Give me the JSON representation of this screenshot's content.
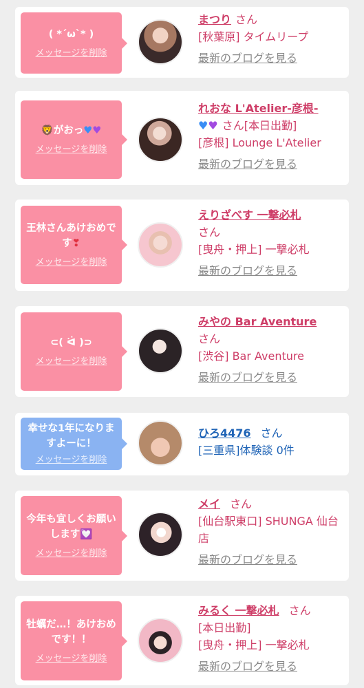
{
  "delete_label": "メッセージを削除",
  "san_label": "さん",
  "blog_label": "最新のブログを見る",
  "colors": {
    "pink_bubble": "#fa90a4",
    "blue_bubble": "#8ab3f2",
    "name_pink": "#ce3d67",
    "name_blue": "#1e63b6",
    "link_gray": "#8a8a8a"
  },
  "items": [
    {
      "message": "( *´ω`* )",
      "name": "まつり",
      "lines": [
        "[秋葉原] タイムリープ"
      ]
    },
    {
      "message": "がおっ",
      "name": "れおな L'Atelier-彦根-",
      "lines": [
        "[本日出勤]",
        "[彦根] Lounge L'Atelier"
      ]
    },
    {
      "message": "王林さんあけおめです",
      "name": "えりざべす 一撃必札",
      "lines": [
        "[曳舟・押上] 一撃必札"
      ]
    },
    {
      "message": "⊂( ᐛ )⊃",
      "name": "みやの Bar Aventure",
      "lines": [
        "[渋谷] Bar Aventure"
      ]
    },
    {
      "message": "幸せな1年になりますよーに！",
      "name": "ひろ4476",
      "lines": [
        "[三重県]体験談 0件"
      ]
    },
    {
      "message": "今年も宜しくお願いします",
      "name": "メイ",
      "lines": [
        "[仙台駅東口] SHUNGA 仙台店"
      ]
    },
    {
      "message": "牡蠣だ…！あけおめです！！",
      "name": "みるく 一撃必札",
      "lines": [
        "[本日出勤]",
        "[曳舟・押上] 一撃必札"
      ]
    }
  ]
}
